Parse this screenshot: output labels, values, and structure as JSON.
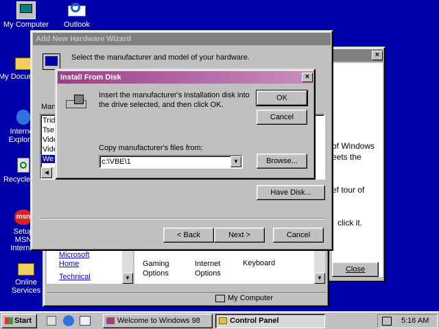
{
  "desktop": {
    "icons": [
      {
        "label": "My Computer"
      },
      {
        "label": "Outlook"
      },
      {
        "label": "My Documents"
      },
      {
        "label": "Internet Explorer"
      },
      {
        "label": "Recycle Bin"
      },
      {
        "label": "Setup MSN Internet"
      },
      {
        "label": "Online Services"
      }
    ]
  },
  "welcome_window": {
    "text1": "of Windows",
    "text2": "eets the",
    "text3": "ef tour of",
    "text4": "click it.",
    "close_label": "Close"
  },
  "control_panel": {
    "links": [
      "Microsoft Home",
      "Technical"
    ],
    "items": [
      "Gaming Options",
      "Internet Options",
      "Keyboard"
    ],
    "status": "My Computer"
  },
  "wizard": {
    "title": "Add New Hardware Wizard",
    "instruction": "Select the manufacturer and model of your hardware.",
    "manufacturers_label": "Manu",
    "list_items": [
      "Trid",
      "Tse",
      "Vide",
      "Vide",
      "We"
    ],
    "have_disk": "Have Disk...",
    "back": "< Back",
    "next": "Next >",
    "cancel": "Cancel"
  },
  "install_dialog": {
    "title": "Install From Disk",
    "message": "Insert the manufacturer's installation disk into the drive selected, and then click OK.",
    "copy_label": "Copy manufacturer's files from:",
    "path_value": "c:\\VBE\\1",
    "ok": "OK",
    "cancel": "Cancel",
    "browse": "Browse..."
  },
  "taskbar": {
    "start": "Start",
    "tasks": [
      "Welcome to Windows 98",
      "Control Panel"
    ],
    "clock": "5:16 AM"
  }
}
